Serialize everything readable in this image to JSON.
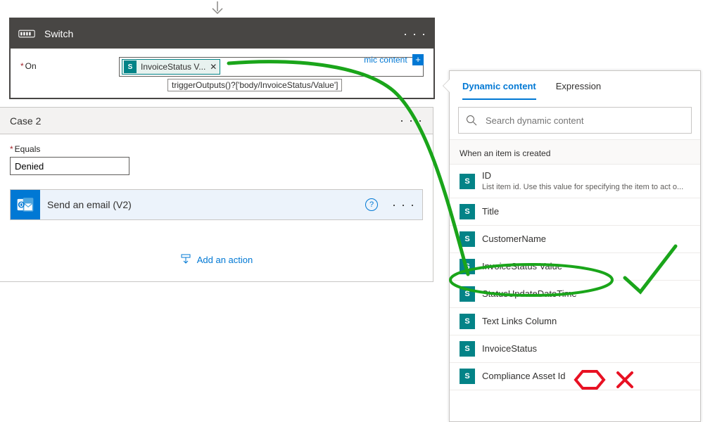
{
  "switch": {
    "title": "Switch",
    "on_label": "On",
    "token_label": "InvoiceStatus V...",
    "dyn_link_partial": "mic content",
    "tooltip": "triggerOutputs()?['body/InvoiceStatus/Value']"
  },
  "case": {
    "title": "Case 2",
    "equals_label": "Equals",
    "equals_value": "Denied",
    "action_title": "Send an email (V2)",
    "add_action": "Add an action"
  },
  "dc": {
    "tab_dynamic": "Dynamic content",
    "tab_expression": "Expression",
    "search_placeholder": "Search dynamic content",
    "section": "When an item is created",
    "items": [
      {
        "name": "ID",
        "desc": "List item id. Use this value for specifying the item to act o..."
      },
      {
        "name": "Title",
        "desc": ""
      },
      {
        "name": "CustomerName",
        "desc": ""
      },
      {
        "name": "InvoiceStatus Value",
        "desc": ""
      },
      {
        "name": "StatusUpdateDateTime",
        "desc": ""
      },
      {
        "name": "Text Links Column",
        "desc": ""
      },
      {
        "name": "InvoiceStatus",
        "desc": ""
      },
      {
        "name": "Compliance Asset Id",
        "desc": ""
      }
    ]
  }
}
